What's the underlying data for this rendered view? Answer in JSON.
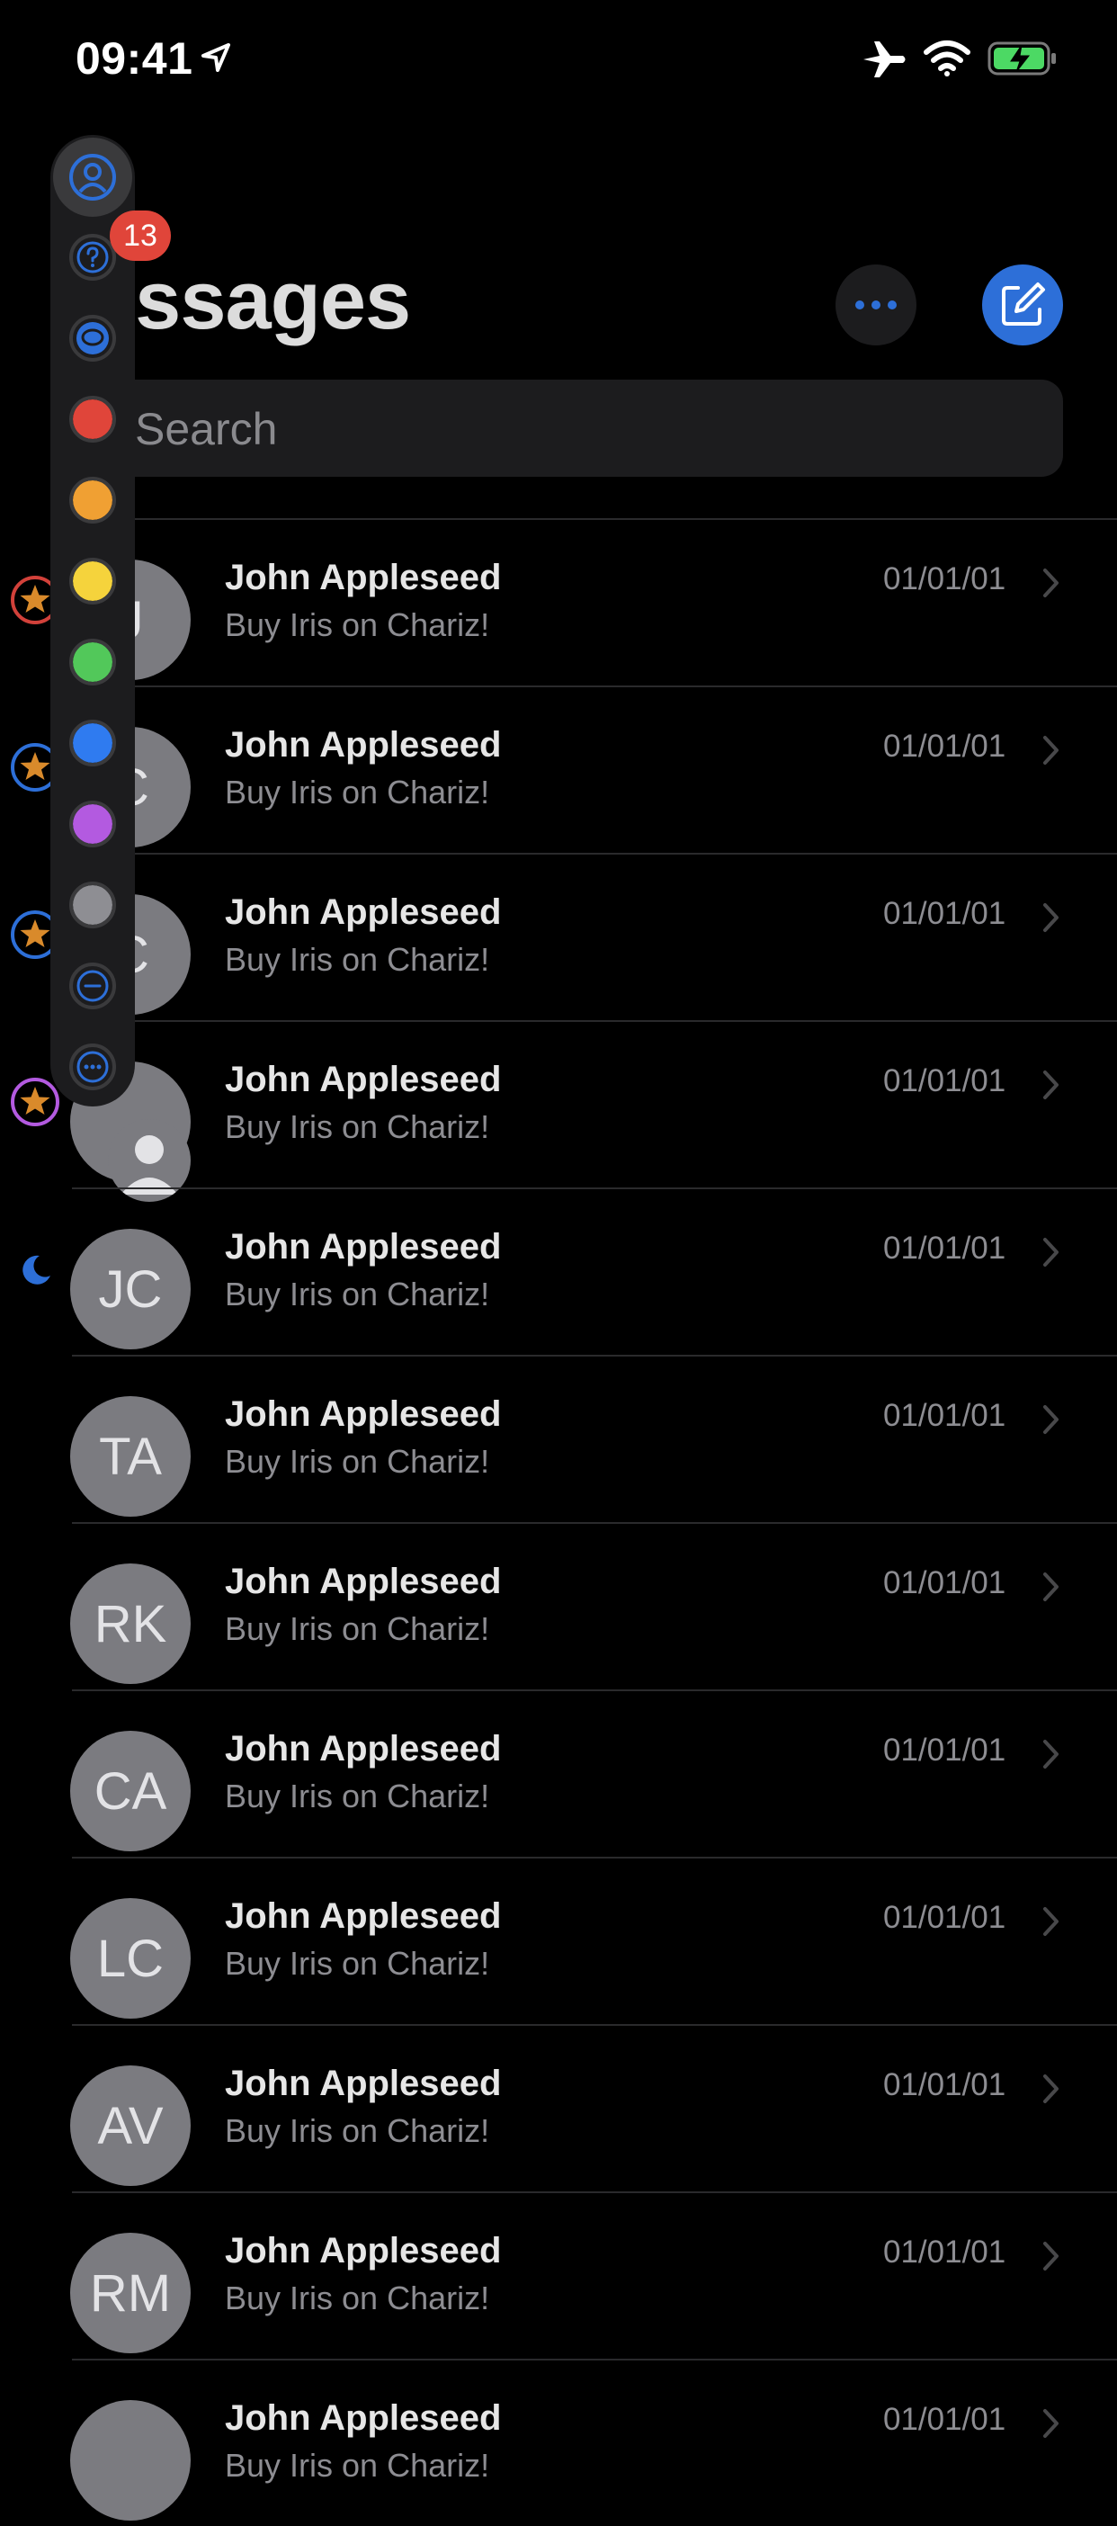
{
  "status_bar": {
    "time": "09:41",
    "icons": [
      "location-arrow-icon",
      "airplane-icon",
      "wifi-icon",
      "battery-charging-icon"
    ]
  },
  "header": {
    "title": "essages",
    "more_icon": "ellipsis-icon",
    "compose_icon": "compose-icon"
  },
  "search": {
    "placeholder": "Search"
  },
  "conversations": [
    {
      "initials": "J",
      "name": "John Appleseed",
      "preview": "Buy Iris on Chariz!",
      "date": "01/01/01",
      "marker": "star-red"
    },
    {
      "initials": "C",
      "name": "John Appleseed",
      "preview": "Buy Iris on Chariz!",
      "date": "01/01/01",
      "marker": "star-blue"
    },
    {
      "initials": "C",
      "name": "John Appleseed",
      "preview": "Buy Iris on Chariz!",
      "date": "01/01/01",
      "marker": "star-blue"
    },
    {
      "initials": "",
      "name": "John Appleseed",
      "preview": "Buy Iris on Chariz!",
      "date": "01/01/01",
      "marker": "star-purple"
    },
    {
      "initials": "JC",
      "name": "John Appleseed",
      "preview": "Buy Iris on Chariz!",
      "date": "01/01/01",
      "marker": "moon"
    },
    {
      "initials": "TA",
      "name": "John Appleseed",
      "preview": "Buy Iris on Chariz!",
      "date": "01/01/01"
    },
    {
      "initials": "RK",
      "name": "John Appleseed",
      "preview": "Buy Iris on Chariz!",
      "date": "01/01/01"
    },
    {
      "initials": "CA",
      "name": "John Appleseed",
      "preview": "Buy Iris on Chariz!",
      "date": "01/01/01"
    },
    {
      "initials": "LC",
      "name": "John Appleseed",
      "preview": "Buy Iris on Chariz!",
      "date": "01/01/01"
    },
    {
      "initials": "AV",
      "name": "John Appleseed",
      "preview": "Buy Iris on Chariz!",
      "date": "01/01/01"
    },
    {
      "initials": "RM",
      "name": "John Appleseed",
      "preview": "Buy Iris on Chariz!",
      "date": "01/01/01"
    },
    {
      "initials": "",
      "name": "John Appleseed",
      "preview": "Buy Iris on Chariz!",
      "date": "01/01/01"
    }
  ],
  "filter_sidebar": {
    "unread_count": "13",
    "filters": [
      {
        "icon": "person-circle-icon",
        "color": "#2d6fd8"
      },
      {
        "icon": "question-circle-icon",
        "color": "#2d6fd8"
      },
      {
        "icon": "message-bubble-icon",
        "color": "#2d6fd8"
      },
      {
        "icon": "red-dot-icon",
        "color": "#e0453a"
      },
      {
        "icon": "orange-dot-icon",
        "color": "#f0a033"
      },
      {
        "icon": "yellow-dot-icon",
        "color": "#f5d33c"
      },
      {
        "icon": "green-dot-icon",
        "color": "#52c85a"
      },
      {
        "icon": "blue-dot-icon",
        "color": "#2f7bf0"
      },
      {
        "icon": "purple-dot-icon",
        "color": "#b35ae0"
      },
      {
        "icon": "gray-dot-icon",
        "color": "#8e8e93"
      },
      {
        "icon": "minus-circle-icon",
        "color": "#2d6fd8"
      },
      {
        "icon": "ellipsis-circle-icon",
        "color": "#2d6fd8"
      }
    ]
  },
  "colors": {
    "accent": "#2d6fd8",
    "badge": "#e0453a",
    "star": "#d98a2b",
    "avatar": "#7b7b80"
  }
}
